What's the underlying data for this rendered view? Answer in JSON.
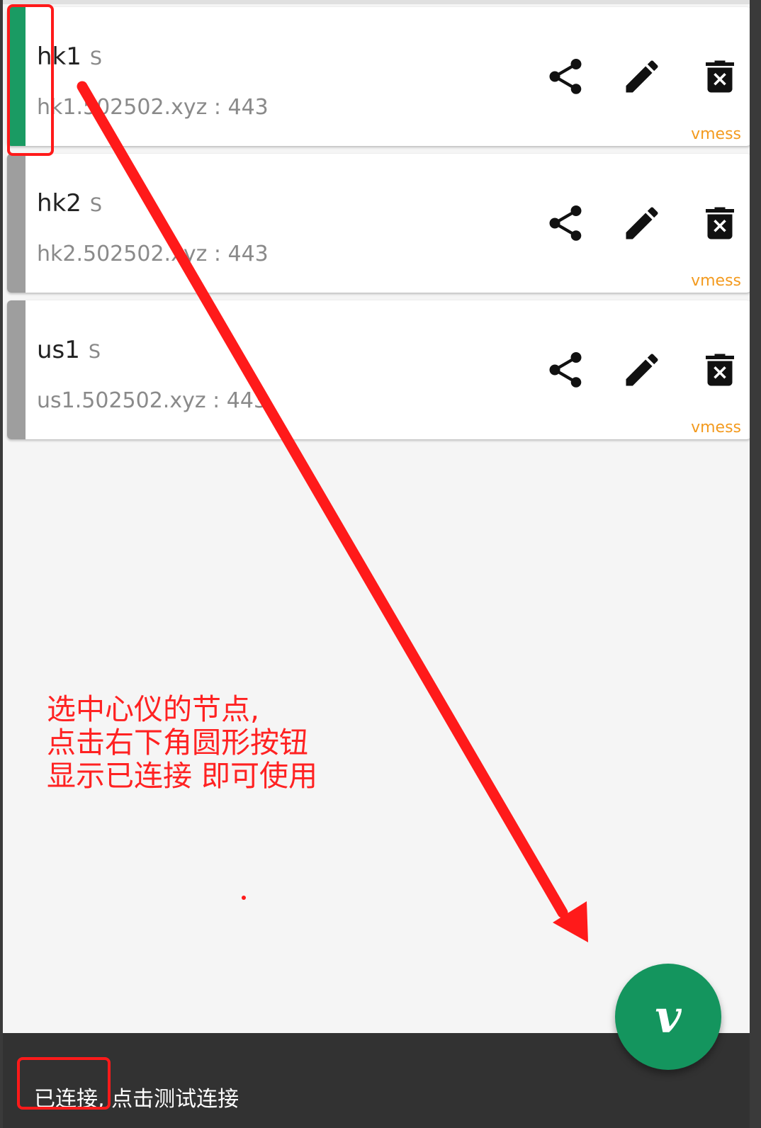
{
  "servers": [
    {
      "name": "hk1",
      "subtype": "S",
      "address": "hk1.502502.xyz : 443",
      "protocol": "vmess",
      "selected": true
    },
    {
      "name": "hk2",
      "subtype": "S",
      "address": "hk2.502502.xyz : 443",
      "protocol": "vmess",
      "selected": false
    },
    {
      "name": "us1",
      "subtype": "S",
      "address": "us1.502502.xyz : 443",
      "protocol": "vmess",
      "selected": false
    }
  ],
  "icons": {
    "share": "share-icon",
    "edit": "edit-icon",
    "delete": "delete-icon",
    "fab": "v-logo-icon"
  },
  "annotation": {
    "note": "选中心仪的节点,\n点击右下角圆形按钮\n显示已连接 即可使用"
  },
  "status": {
    "text": "已连接, 点击测试连接"
  },
  "fab": {
    "glyph": "v"
  },
  "colors": {
    "selected": "#1a9b63",
    "unselected": "#9e9e9e",
    "protocol": "#f39a1e",
    "fab": "#14955e",
    "annotation": "#ff1a1a"
  }
}
